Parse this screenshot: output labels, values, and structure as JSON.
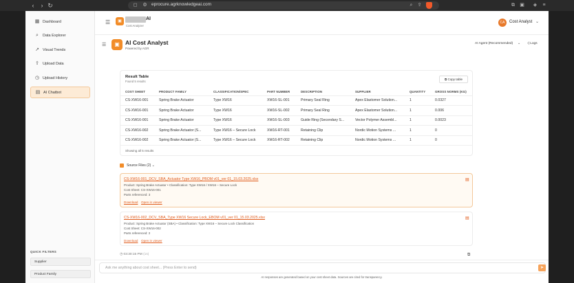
{
  "browser": {
    "url": "eprocure.agrknowledgeai.com"
  },
  "topbar": {
    "brand_ai": "AI",
    "brand_sub": "Cost Analyzer",
    "user_initials": "CA",
    "user_name": "Cost Analyst"
  },
  "header": {
    "title": "AI Cost Analyst",
    "subtitle": "Powered by AGR",
    "agent": "AI Agent (Recommended)",
    "logs": "Logs"
  },
  "sidebar": {
    "items": [
      {
        "label": "Dashboard",
        "icon": "grid-icon"
      },
      {
        "label": "Data Explorer",
        "icon": "search-icon"
      },
      {
        "label": "Visual Trends",
        "icon": "trend-icon"
      },
      {
        "label": "Upload Data",
        "icon": "upload-icon"
      },
      {
        "label": "Upload History",
        "icon": "history-icon"
      },
      {
        "label": "AI Chatbot",
        "icon": "chat-icon"
      }
    ],
    "quick_filters_title": "QUICK FILTERS",
    "quick_filters": [
      "Supplier",
      "Product Family"
    ]
  },
  "result_table": {
    "title": "Result Table",
    "subtitle": "Found 5 results",
    "copy_label": "Copy table",
    "columns": [
      "COST SHEET",
      "PRODUCT FAMILY",
      "CLASSIFICATION/SPEC",
      "PART NUMBER",
      "DESCRIPTION",
      "SUPPLIER",
      "QUANTITY",
      "GROSS NORMS (KG)"
    ],
    "rows": [
      [
        "CS-XW16-001",
        "Spring Brake Actuator",
        "Type XW16",
        "XW16-SL-001",
        "Primary Seal Ring",
        "Apex Elastomer Solution...",
        "1",
        "0.0327"
      ],
      [
        "CS-XW16-001",
        "Spring Brake Actuator",
        "Type XW16",
        "XW16-SL-002",
        "Primary Seal Ring",
        "Apex Elastomer Solution...",
        "1",
        "0.006"
      ],
      [
        "CS-XW16-001",
        "Spring Brake Actuator",
        "Type XW16",
        "XW16-SL-003",
        "Guide Ring (Secondary S...",
        "Vector Polymer Assembl...",
        "1",
        "0.0023"
      ],
      [
        "CS-XW16-002",
        "Spring Brake Actuator (S...",
        "Type XW16 – Secure Lock",
        "XW16-RT-001",
        "Retaining Clip",
        "Nordic Motion Systems ...",
        "1",
        "0"
      ],
      [
        "CS-XW16-002",
        "Spring Brake Actuator (S...",
        "Type XW16 – Secure Lock",
        "XW16-RT-002",
        "Retaining Clip",
        "Nordic Motion Systems ...",
        "1",
        "0"
      ]
    ],
    "showing": "Showing all 5 results"
  },
  "source_files": {
    "heading": "Source Files (2)",
    "files": [
      {
        "name": "CS-XW16-001_DCV_SBA_Actuator Type XW16_PBOM v01_ver 01_15.03.2025.xlsx",
        "product": "Product: Spring Brake Actuator • Classification: Type XW16 / XW16 – Secure Lock",
        "cost_sheet": "Cost Sheet: CS-XW16-001",
        "parts": "Parts referenced: 3",
        "download": "Download",
        "open": "Open in viewer"
      },
      {
        "name": "CS-XW16-002_DCV_SBA_Type XW16 Secure Lock_EBOM v01_ver 01_15.03.2025.xlsx",
        "product": "Product: Spring Brake Actuator (SBA) • Classification: Type XW16 – Secure Lock Classification",
        "cost_sheet": "Cost Sheet: CS-XW16-002",
        "parts": "Parts referenced: 2",
        "download": "Download",
        "open": "Open in viewer"
      }
    ]
  },
  "message_meta": {
    "time": "03:30:15 PM",
    "suffix": "(1s)"
  },
  "input": {
    "placeholder": "Ask me anything about cost sheet... (Press Enter to send)",
    "disclaimer": "AI responses are generated based on your cost sheet data. Sources are cited for transparency."
  }
}
